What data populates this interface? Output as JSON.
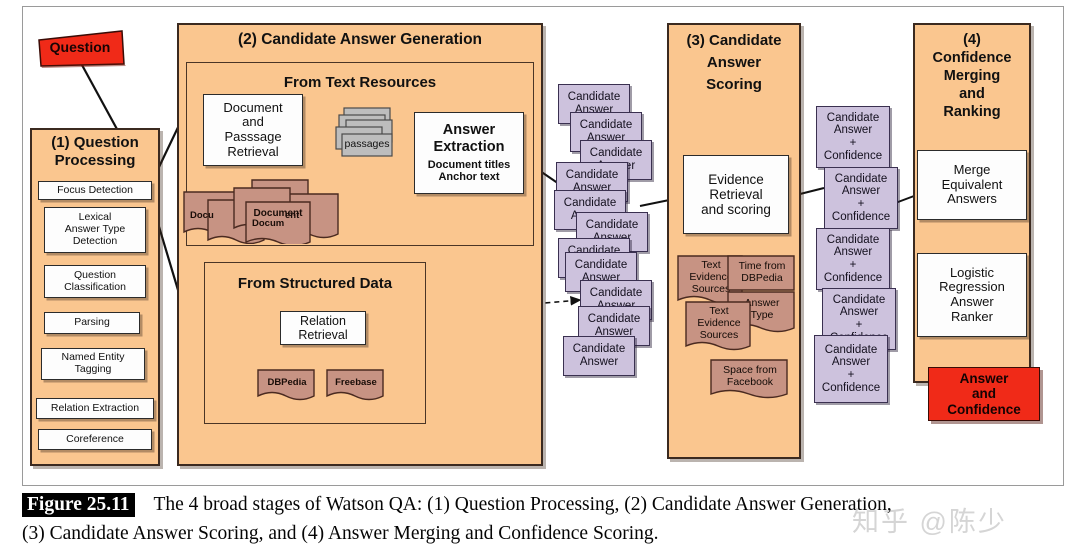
{
  "figure": {
    "tag": "Figure 25.11",
    "caption_line1": "The 4 broad stages of Watson QA: (1) Question Processing, (2) Candidate Answer Generation,",
    "caption_line2": "(3) Candidate Answer Scoring, and (4) Answer Merging and Confidence Scoring.",
    "watermark": "知乎 @陈少"
  },
  "colors": {
    "panel": "#fac68f",
    "white_box": "#fdfdfd",
    "candidate": "#cdc2dd",
    "document": "#c79383",
    "passage": "#bdbdbd",
    "red": "#f02a18",
    "outline": "#2b2b2b"
  },
  "question": {
    "label": "Question"
  },
  "stage1": {
    "title_line1": "(1) Question",
    "title_line2": "Processing",
    "items": [
      {
        "label": "Focus Detection"
      },
      {
        "label": "Lexical\nAnswer Type\nDetection"
      },
      {
        "label": "Question\nClassification"
      },
      {
        "label": "Parsing"
      },
      {
        "label": "Named Entity\nTagging"
      },
      {
        "label": "Relation Extraction"
      },
      {
        "label": "Coreference"
      }
    ]
  },
  "stage2": {
    "title": "(2) Candidate Answer Generation",
    "text_resources": {
      "title": "From Text Resources",
      "retrieval": "Document\nand\nPasssage\nRetrieval",
      "passages_label": "passages",
      "documents_label": "Document",
      "answer_extraction": {
        "title": "Answer\nExtraction",
        "detail_line1": "Document titles",
        "detail_line2": "Anchor text"
      }
    },
    "structured_data": {
      "title": "From Structured Data",
      "relation_retrieval": "Relation\nRetrieval",
      "sources": [
        {
          "label": "DBPedia"
        },
        {
          "label": "Freebase"
        }
      ]
    }
  },
  "candidate_answers": {
    "label": "Candidate\nAnswer",
    "count": 12
  },
  "stage3": {
    "title_line1": "(3) Candidate",
    "title_line2": "Answer",
    "title_line3": "Scoring",
    "evidence": "Evidence\nRetrieval\nand scoring",
    "evidence_sources": [
      {
        "label": "Text\nEvidence\nSources"
      },
      {
        "label": "Time from\nDBPedia"
      },
      {
        "label": "Answer\nType"
      },
      {
        "label": "Text\nEvidence\nSources"
      },
      {
        "label": "Space from\nFacebook"
      }
    ]
  },
  "candidate_confidence": {
    "label": "Candidate\nAnswer\n+\nConfidence",
    "count": 7
  },
  "stage4": {
    "title_line1": "(4)",
    "title_line2": "Confidence",
    "title_line3": "Merging",
    "title_line4": "and",
    "title_line5": "Ranking",
    "merge": "Merge\nEquivalent\nAnswers",
    "ranker": "Logistic\nRegression\nAnswer\nRanker"
  },
  "answer": {
    "label": "Answer\nand\nConfidence"
  }
}
